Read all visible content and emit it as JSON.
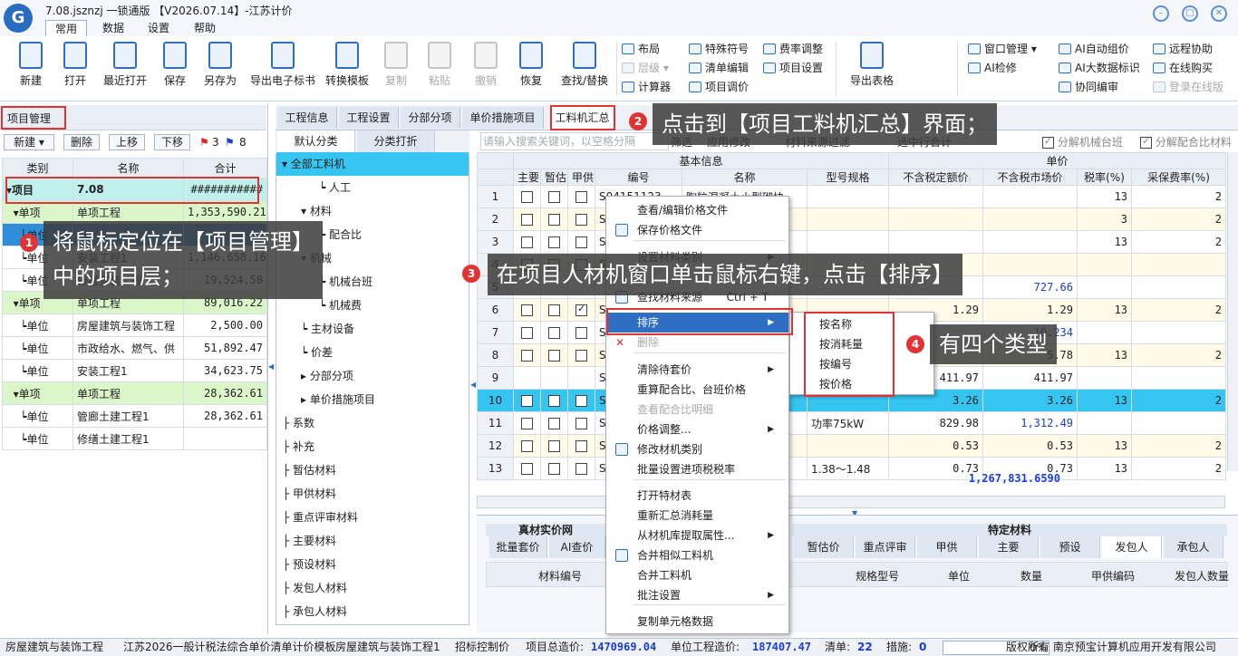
{
  "window": {
    "title": "7.08.jsznzj 一锁通版 【V2026.07.14】-江苏计价",
    "logo": "G"
  },
  "menu_tabs": [
    "常用",
    "数据",
    "设置",
    "帮助"
  ],
  "toolbar": {
    "big": [
      "新建",
      "打开",
      "最近打开",
      "保存",
      "另存为",
      "导出电子标书",
      "转换模板",
      "复制",
      "粘贴",
      "撤销",
      "恢复",
      "查找/替换"
    ],
    "small_1": [
      "布局",
      "层级",
      "计算器"
    ],
    "small_2": [
      "特殊符号",
      "清单编辑",
      "项目调价"
    ],
    "small_3": [
      "费率调整",
      "项目设置"
    ],
    "export": "导出表格",
    "small_4": [
      "窗口管理",
      "AI检修"
    ],
    "small_5": [
      "AI自动组价",
      "AI大数据标识",
      "协同编审"
    ],
    "small_6": [
      "远程协助",
      "在线购买",
      "登录在线版"
    ]
  },
  "left": {
    "title": "项目管理",
    "buttons": [
      "新建",
      "删除",
      "上移",
      "下移"
    ],
    "flag_red": "3",
    "flag_blue": "8",
    "headers": [
      "类别",
      "名称",
      "合计"
    ],
    "rows": [
      {
        "cat": "项目",
        "name": "7.08",
        "total": "###########",
        "type": "proj"
      },
      {
        "cat": "单项",
        "name": "单项工程",
        "total": "1,353,590.21",
        "type": "unit"
      },
      {
        "cat": "单位",
        "name": "",
        "total": "",
        "type": "sel"
      },
      {
        "cat": "单位",
        "name": "安装工程1",
        "total": "1,146,658.16",
        "type": ""
      },
      {
        "cat": "单位",
        "name": "修缮安装工程",
        "total": "19,524.58",
        "type": ""
      },
      {
        "cat": "单项",
        "name": "单项工程",
        "total": "89,016.22",
        "type": "unit"
      },
      {
        "cat": "单位",
        "name": "房屋建筑与装饰工程",
        "total": "2,500.00",
        "type": ""
      },
      {
        "cat": "单位",
        "name": "市政给水、燃气、供",
        "total": "51,892.47",
        "type": ""
      },
      {
        "cat": "单位",
        "name": "安装工程1",
        "total": "34,623.75",
        "type": ""
      },
      {
        "cat": "单项",
        "name": "单项工程",
        "total": "28,362.61",
        "type": "unit"
      },
      {
        "cat": "单位",
        "name": "管廊土建工程1",
        "total": "28,362.61",
        "type": ""
      },
      {
        "cat": "单位",
        "name": "修缮土建工程1",
        "total": "",
        "type": ""
      }
    ]
  },
  "content_tabs": [
    "工程信息",
    "工程设置",
    "分部分项",
    "单价措施项目",
    "工料机汇总"
  ],
  "classify_tabs": [
    "默认分类",
    "分类打折"
  ],
  "tree": [
    "全部工料机",
    "人工",
    "材料",
    "配合比",
    "机械",
    "机械台班",
    "机械费",
    "主材设备",
    "价差",
    "分部分项",
    "单价措施项目",
    "系数",
    "补充",
    "暂估材料",
    "甲供材料",
    "重点评审材料",
    "主要材料",
    "预设材料",
    "发包人材料",
    "承包人材料"
  ],
  "search": {
    "placeholder": "请输入搜索关键词，以空格分隔",
    "filter": "筛选",
    "apply": "应用修改",
    "source_filter": "材料来源过滤",
    "select_all": "选中行合计"
  },
  "top_checks": [
    "分解机械台班",
    "分解配合比材料"
  ],
  "grid": {
    "group_basic": "基本信息",
    "group_price": "单价",
    "headers": [
      "主要",
      "暂估",
      "甲供",
      "编号",
      "名称",
      "型号规格",
      "不含税定额价",
      "不含税市场价",
      "税率(%)",
      "采保费率(%)"
    ],
    "rows": [
      {
        "no": "1",
        "code": "S04151123",
        "name": "陶粒混凝土小型砌块",
        "spec": "",
        "quota": "",
        "market": "",
        "tax": "13",
        "fee": "2"
      },
      {
        "no": "2",
        "code": "S0",
        "name": "",
        "spec": "",
        "quota": "",
        "market": "",
        "tax": "3",
        "fee": "2"
      },
      {
        "no": "3",
        "code": "S0",
        "name": "",
        "spec": "",
        "quota": "",
        "market": "",
        "tax": "13",
        "fee": "2"
      },
      {
        "no": "4",
        "code": "S0",
        "name": "",
        "spec": "",
        "quota": "",
        "market": "",
        "tax": "",
        "fee": ""
      },
      {
        "no": "5",
        "code": "",
        "name": "",
        "spec": "",
        "quota": "",
        "market": "727.66",
        "tax": "",
        "fee": ""
      },
      {
        "no": "6",
        "code": "S0",
        "name": "",
        "spec": "",
        "quota": "1.29",
        "market": "1.29",
        "tax": "13",
        "fee": "2"
      },
      {
        "no": "7",
        "code": "S0",
        "name": "",
        "spec": "",
        "quota": "",
        "market": "10.234",
        "tax": "",
        "fee": ""
      },
      {
        "no": "8",
        "code": "S0",
        "name": "",
        "spec": "",
        "quota": "",
        "market": "5.78",
        "tax": "13",
        "fee": "2"
      },
      {
        "no": "9",
        "code": "S0",
        "name": "",
        "spec": "",
        "quota": "411.97",
        "market": "411.97",
        "tax": "",
        "fee": ""
      },
      {
        "no": "10",
        "code": "S",
        "name": "",
        "spec": "",
        "quota": "3.26",
        "market": "3.26",
        "tax": "13",
        "fee": "2"
      },
      {
        "no": "11",
        "code": "S9",
        "name": "",
        "spec": "功率75kW",
        "quota": "829.98",
        "market": "1,312.49",
        "tax": "",
        "fee": ""
      },
      {
        "no": "12",
        "code": "S0",
        "name": "",
        "spec": "",
        "quota": "0.53",
        "market": "0.53",
        "tax": "13",
        "fee": "2"
      },
      {
        "no": "13",
        "code": "S1",
        "name": "",
        "spec": "1.38～1.48",
        "quota": "0.73",
        "market": "0.73",
        "tax": "13",
        "fee": "2"
      }
    ],
    "total": "1,267,831.6590"
  },
  "bottom": {
    "left_title": "真材实价网",
    "left_buttons": [
      "批量套价",
      "AI查价"
    ],
    "right_title": "特定材料",
    "right_tabs": [
      "暂估价",
      "重点评审",
      "甲供",
      "主要",
      "预设",
      "发包人",
      "承包人"
    ],
    "headers_left": [
      "材料编号"
    ],
    "headers_right": [
      "规格型号",
      "单位",
      "数量",
      "甲供编码",
      "发包人数量"
    ]
  },
  "context_menu": [
    {
      "label": "查看/编辑价格文件",
      "state": ""
    },
    {
      "label": "保存价格文件",
      "state": ""
    },
    {
      "label": "设置材料类别",
      "state": "",
      "arrow": true
    },
    {
      "label": "查找材料来源",
      "state": "",
      "shortcut": "Ctrl + T"
    },
    {
      "label": "排序",
      "state": "hl",
      "arrow": true
    },
    {
      "label": "删除",
      "state": "dis"
    },
    {
      "label": "清除待套价",
      "state": "",
      "arrow": true
    },
    {
      "label": "重算配合比、台班价格",
      "state": ""
    },
    {
      "label": "查看配合比明细",
      "state": "dis"
    },
    {
      "label": "价格调整...",
      "state": "",
      "arrow": true
    },
    {
      "label": "修改材机类别",
      "state": ""
    },
    {
      "label": "批量设置进项税税率",
      "state": ""
    },
    {
      "label": "打开特材表",
      "state": ""
    },
    {
      "label": "重新汇总消耗量",
      "state": ""
    },
    {
      "label": "从材机库提取属性...",
      "state": "",
      "arrow": true
    },
    {
      "label": "合并相似工料机",
      "state": ""
    },
    {
      "label": "合并工料机",
      "state": ""
    },
    {
      "label": "批注设置",
      "state": "",
      "arrow": true
    },
    {
      "label": "复制单元格数据",
      "state": ""
    }
  ],
  "sort_submenu": [
    "按名称",
    "按消耗量",
    "按编号",
    "按价格"
  ],
  "callouts": [
    {
      "num": "1",
      "text": "将鼠标定位在【项目管理】\n中的项目层；"
    },
    {
      "num": "2",
      "text": "点击到【项目工料机汇总】界面；"
    },
    {
      "num": "3",
      "text": "在项目人材机窗口单击鼠标右键，点击【排序】"
    },
    {
      "num": "4",
      "text": "有四个类型"
    }
  ],
  "status": {
    "s1": "房屋建筑与装饰工程",
    "s2": "江苏2026一般计税法综合单价清单计价模板",
    "s3": "房屋建筑与装饰工程1",
    "s4": "招标控制价",
    "s5_label": "项目总造价:",
    "s5_val": "1470969.04",
    "s6_label": "单位工程造价:",
    "s6_val": "187407.47",
    "s7_label": "清单:",
    "s7_val": "22",
    "s8_label": "措施:",
    "s8_val": "0",
    "progress": "0%",
    "copyright": "版权所有 南京预宝计算机应用开发有限公司"
  }
}
